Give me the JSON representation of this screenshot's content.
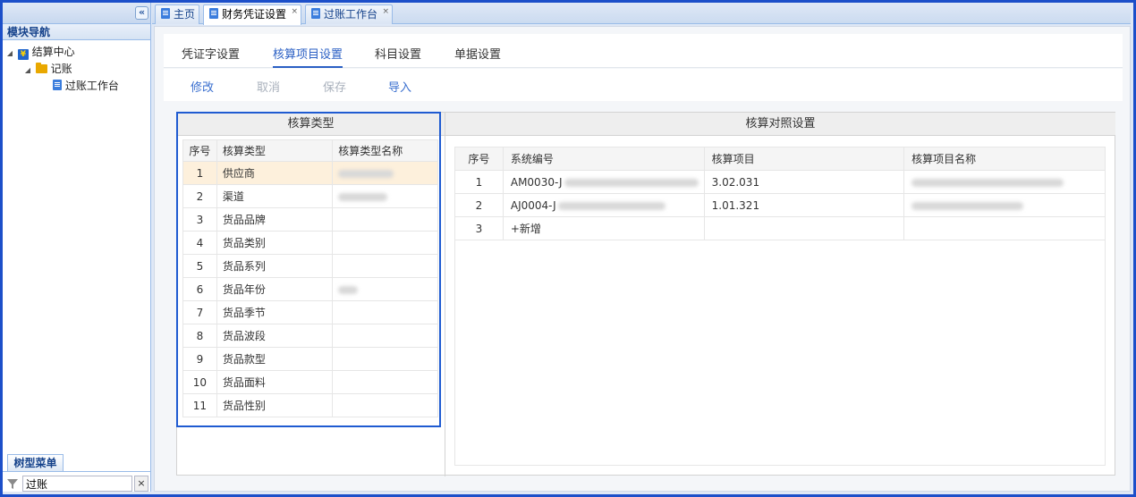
{
  "sidebar": {
    "collapse_icon": "double-chevron-left-icon",
    "nav_title": "模块导航",
    "tree": [
      {
        "label": "结算中心",
        "icon": "yen-icon",
        "level": 0
      },
      {
        "label": "记账",
        "icon": "folder-icon",
        "level": 1
      },
      {
        "label": "过账工作台",
        "icon": "document-icon",
        "level": 2
      }
    ],
    "bottom_tab": "树型菜单",
    "search_value": "过账",
    "clear_label": "×"
  },
  "tabs": [
    {
      "label": "主页",
      "closable": false
    },
    {
      "label": "财务凭证设置",
      "closable": true,
      "active": true
    },
    {
      "label": "过账工作台",
      "closable": true
    }
  ],
  "tab_close_symbol": "×",
  "subtabs": [
    {
      "label": "凭证字设置"
    },
    {
      "label": "核算项目设置",
      "active": true
    },
    {
      "label": "科目设置"
    },
    {
      "label": "单据设置"
    }
  ],
  "toolbar": {
    "edit": "修改",
    "cancel": "取消",
    "save": "保存",
    "import": "导入"
  },
  "left_panel": {
    "title": "核算类型",
    "columns": [
      "序号",
      "核算类型",
      "核算类型名称"
    ],
    "rows": [
      {
        "no": "1",
        "type": "供应商"
      },
      {
        "no": "2",
        "type": "渠道"
      },
      {
        "no": "3",
        "type": "货品品牌"
      },
      {
        "no": "4",
        "type": "货品类别"
      },
      {
        "no": "5",
        "type": "货品系列"
      },
      {
        "no": "6",
        "type": "货品年份"
      },
      {
        "no": "7",
        "type": "货品季节"
      },
      {
        "no": "8",
        "type": "货品波段"
      },
      {
        "no": "9",
        "type": "货品款型"
      },
      {
        "no": "10",
        "type": "货品面料"
      },
      {
        "no": "11",
        "type": "货品性别"
      }
    ]
  },
  "right_panel": {
    "title": "核算对照设置",
    "columns": [
      "序号",
      "系统编号",
      "核算项目",
      "核算项目名称"
    ],
    "rows": [
      {
        "no": "1",
        "code": "AM0030-J",
        "item": "3.02.031"
      },
      {
        "no": "2",
        "code": "AJ0004-J",
        "item": "1.01.321"
      },
      {
        "no": "3",
        "code": "+新增",
        "item": ""
      }
    ]
  },
  "colors": {
    "accent": "#2a5fc4",
    "frame_border": "#1c4fc9",
    "selected_row": "#fdf0dc",
    "highlight_box": "#1f5bd1"
  }
}
